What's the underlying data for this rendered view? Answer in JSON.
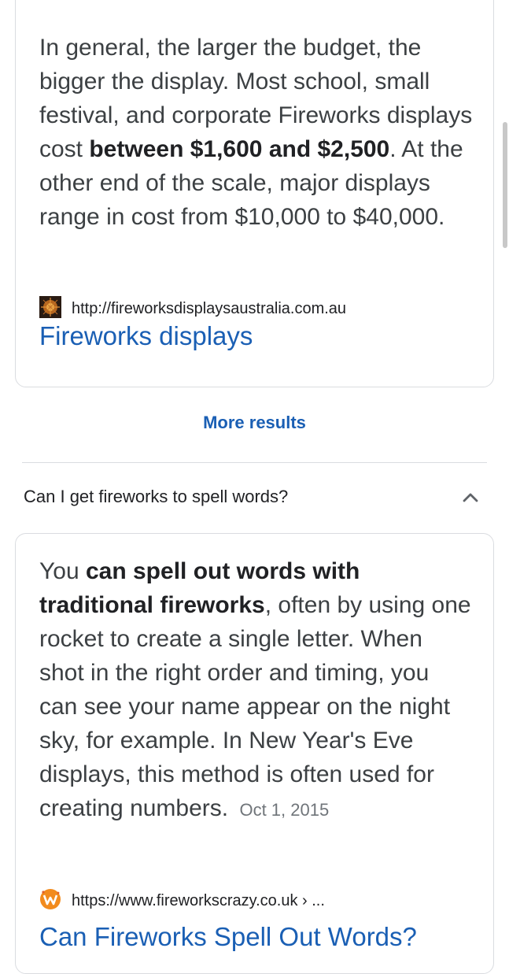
{
  "result1": {
    "text_a": "In general, the larger the budget, the bigger the display. Most school, small festival, and corporate Fireworks displays cost ",
    "text_bold": "between $1,600 and $2,500",
    "text_b": ". At the other end of the scale, major displays range in cost from $10,000 to $40,000.",
    "source_url": "http://fireworksdisplaysaustralia.com.au",
    "link_title": "Fireworks displays",
    "favicon_icon": "fireworks-photo-icon"
  },
  "more_results": "More results",
  "question": {
    "text": "Can I get fireworks to spell words?",
    "expand_icon": "chevron-up-icon"
  },
  "result2": {
    "text_a": "You ",
    "text_bold": "can spell out words with traditional fireworks",
    "text_b": ", often by using one rocket to create a single letter. When shot in the right order and timing, you can see your name appear on the night sky, for example. In New Year's Eve displays, this method is often used for creating numbers.",
    "date": "Oct 1, 2015",
    "source_url": "https://www.fireworkscrazy.co.uk › ...",
    "link_title": "Can Fireworks Spell Out Words?",
    "favicon_icon": "fireworkscrazy-logo-icon"
  },
  "colors": {
    "link": "#1a5fb4",
    "text": "#3c4043",
    "border": "#dadce0",
    "brand_orange": "#f28b1e"
  }
}
